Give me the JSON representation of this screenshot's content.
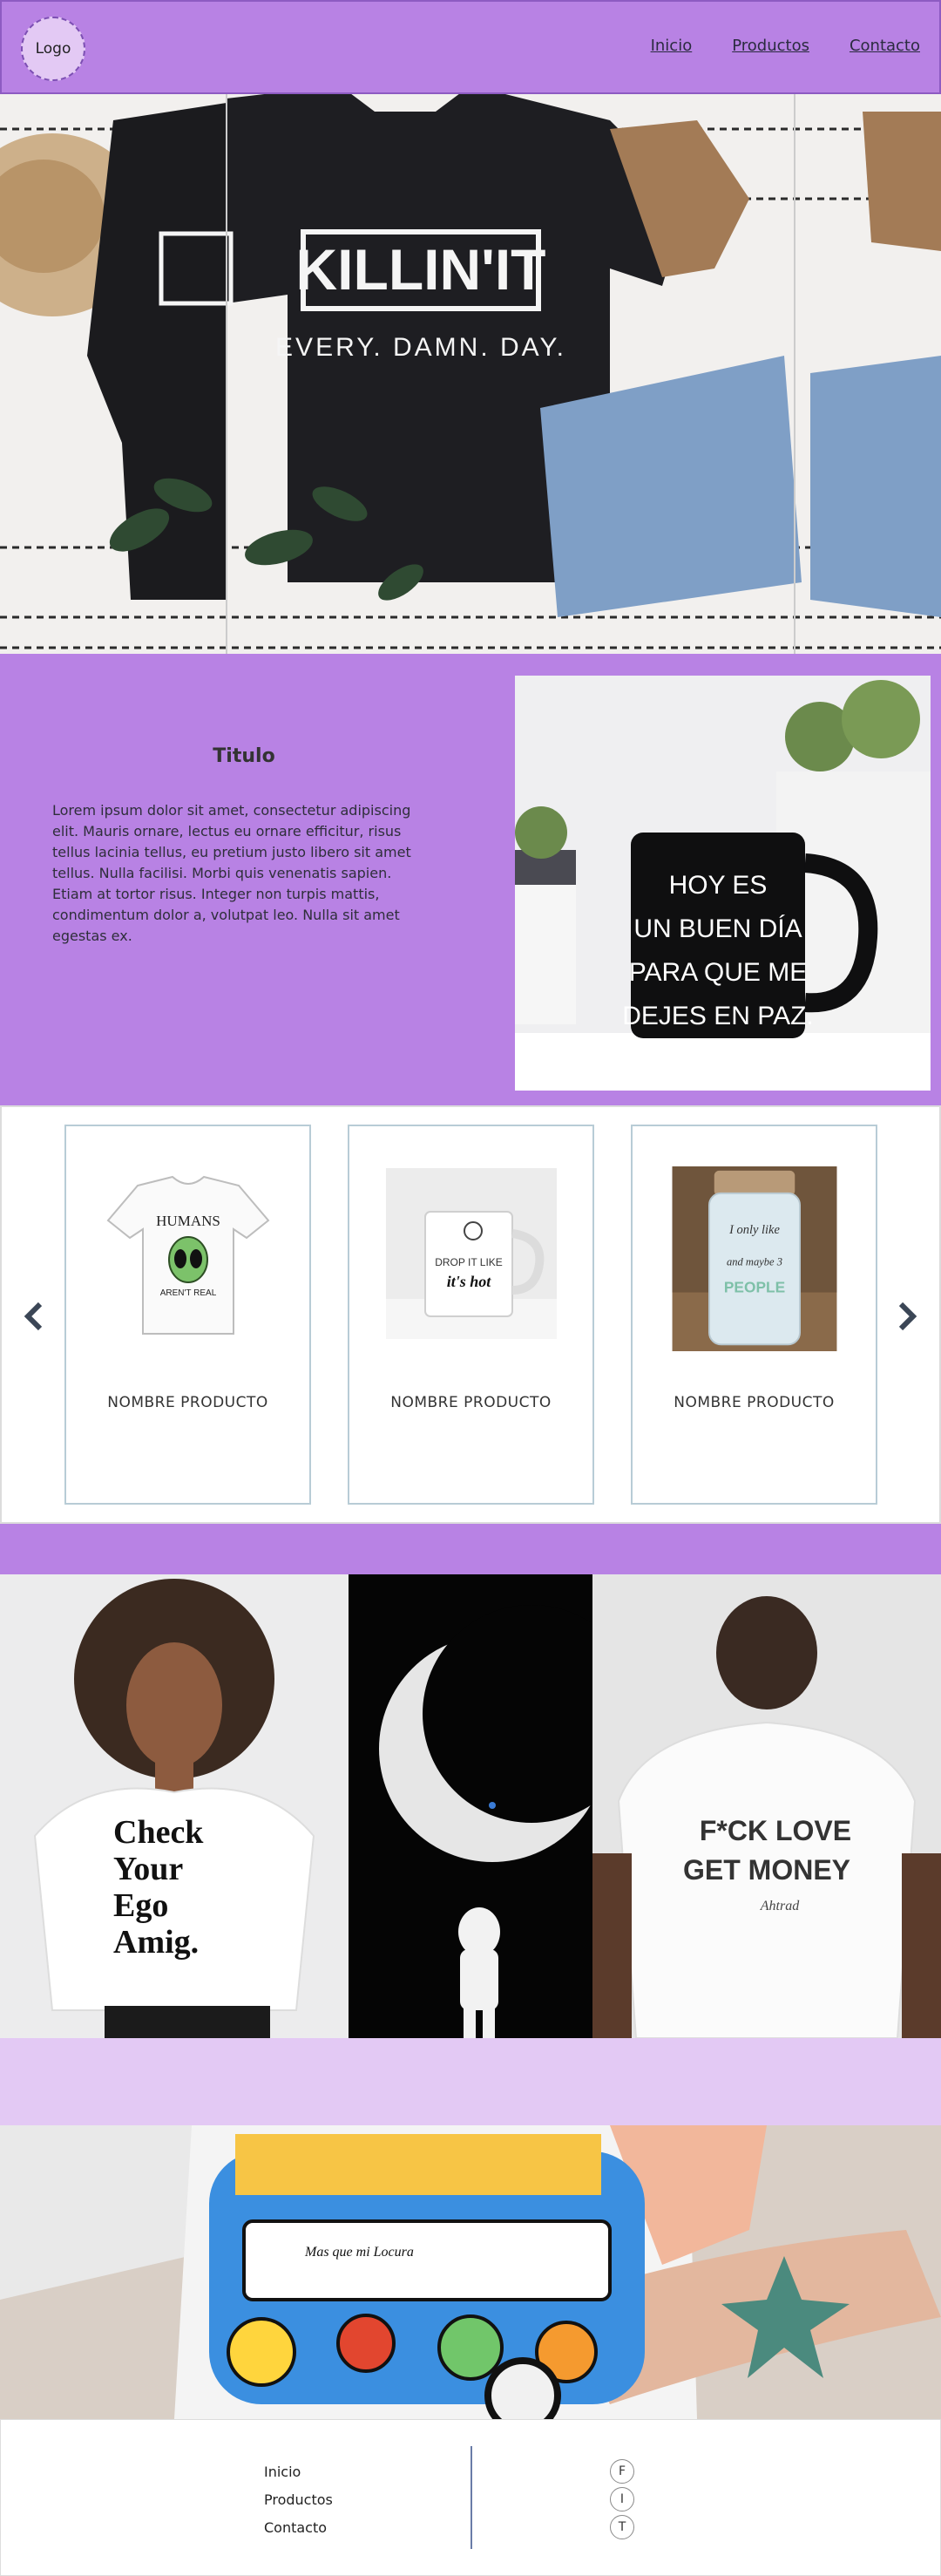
{
  "header": {
    "logo_label": "Logo",
    "nav": {
      "home": "Inicio",
      "products": "Productos",
      "contact": "Contacto"
    }
  },
  "hero": {
    "shirt_line1": "KILLIN'IT",
    "shirt_line2": "EVERY. DAMN. DAY."
  },
  "intro": {
    "title": "Titulo",
    "body": "Lorem ipsum dolor sit amet, consectetur adipiscing elit. Mauris ornare, lectus eu ornare efficitur, risus tellus lacinia tellus, eu pretium justo libero sit amet tellus. Nulla facilisi. Morbi quis venenatis sapien. Etiam at tortor risus. Integer non turpis mattis, condimentum dolor a, volutpat leo. Nulla sit amet egestas ex.",
    "mug_lines": [
      "HOY ES",
      "UN BUEN DÍA",
      "PARA QUE ME",
      "DEJES EN PAZ."
    ]
  },
  "carousel": {
    "products": [
      {
        "name": "NOMBRE  PRODUCTO",
        "print": [
          "HUMANS",
          "AREN'T REAL"
        ]
      },
      {
        "name": "NOMBRE  PRODUCTO",
        "print": [
          "DROP IT LIKE",
          "it's hot"
        ]
      },
      {
        "name": "NOMBRE  PRODUCTO",
        "print": [
          "I only like",
          "and maybe 3",
          "PEOPLE"
        ]
      }
    ]
  },
  "gallery": {
    "shirt1": [
      "Check",
      "Your",
      "Ego",
      "Amig."
    ],
    "shirt3": [
      "F*CK LOVE",
      "GET MONEY",
      "Ahtrad"
    ]
  },
  "wide": {
    "van_text": "Mas que mi Locura"
  },
  "footer": {
    "links": [
      "Inicio",
      "Productos",
      "Contacto"
    ],
    "social": [
      "F",
      "I",
      "T"
    ]
  },
  "colors": {
    "primary": "#b882e4",
    "light": "#e3c9f4",
    "card_border": "#b8ccd6"
  }
}
